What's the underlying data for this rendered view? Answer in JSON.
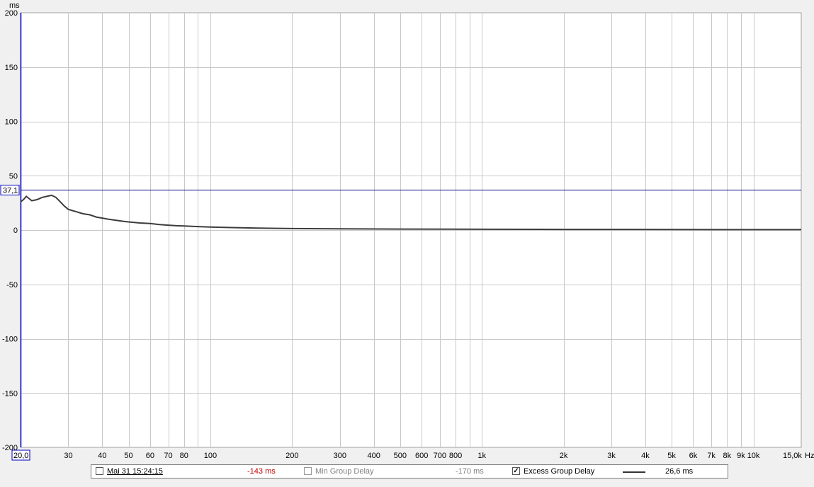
{
  "chart_data": {
    "type": "line",
    "xscale": "log",
    "xlim": [
      20,
      15000
    ],
    "ylim": [
      -200,
      200
    ],
    "yunit_label": "ms",
    "xunit_label": "Hz",
    "grid": true,
    "y_ticks": [
      200,
      150,
      100,
      50,
      0,
      -50,
      -100,
      -150,
      -200
    ],
    "y_tick_labels": [
      "200",
      "150",
      "100",
      "50",
      "0",
      "-50",
      "-100",
      "-150",
      "-200"
    ],
    "x_ticks": [
      30,
      40,
      50,
      60,
      70,
      80,
      100,
      200,
      300,
      400,
      500,
      600,
      700,
      800,
      1000,
      2000,
      3000,
      4000,
      5000,
      6000,
      7000,
      8000,
      9000,
      10000
    ],
    "x_tick_labels": [
      "30",
      "40",
      "50",
      "60",
      "70",
      "80",
      "100",
      "200",
      "300",
      "400",
      "500",
      "600",
      "700",
      "800",
      "1k",
      "2k",
      "3k",
      "4k",
      "5k",
      "6k",
      "7k",
      "8k",
      "9k",
      "10k"
    ],
    "x_minor_ticks": [
      90,
      900
    ],
    "x_start_label": "20,0",
    "x_end_label": "15,0k",
    "cursor_y": 37.1,
    "cursor_y_label": "37,1",
    "series": [
      {
        "color": "#3c3c3c",
        "x": [
          20,
          20.5,
          21,
          21.5,
          22,
          23,
          24,
          25,
          26,
          27,
          28,
          29,
          30,
          32,
          34,
          36,
          38,
          40,
          42,
          45,
          48,
          50,
          55,
          60,
          65,
          70,
          75,
          80,
          90,
          100,
          120,
          150,
          200,
          300,
          500,
          1000,
          2000,
          5000,
          10000,
          15000
        ],
        "y": [
          26,
          28,
          31,
          29,
          27,
          28,
          30,
          31,
          32,
          30,
          26,
          22,
          19,
          17,
          15,
          14,
          12,
          11,
          10,
          9,
          8,
          7.5,
          6.5,
          6,
          5,
          4.5,
          4,
          3.8,
          3.2,
          2.8,
          2.3,
          1.8,
          1.4,
          1.1,
          0.9,
          0.7,
          0.6,
          0.5,
          0.4,
          0.4
        ]
      }
    ]
  },
  "legend": {
    "measurement_name": "Mai 31 15:24:15",
    "measurement_value": "-143 ms",
    "min_group_delay_label": "Min Group Delay",
    "min_group_delay_value": "-170 ms",
    "excess_group_delay_label": "Excess Group Delay",
    "excess_group_delay_value": "26,6 ms"
  },
  "colors": {
    "grid": "#c8c8c8",
    "plot_background": "#ffffff",
    "cursor_line": "#000080",
    "left_axis_accent": "#0000c0",
    "measurement_value": "#c00000"
  }
}
